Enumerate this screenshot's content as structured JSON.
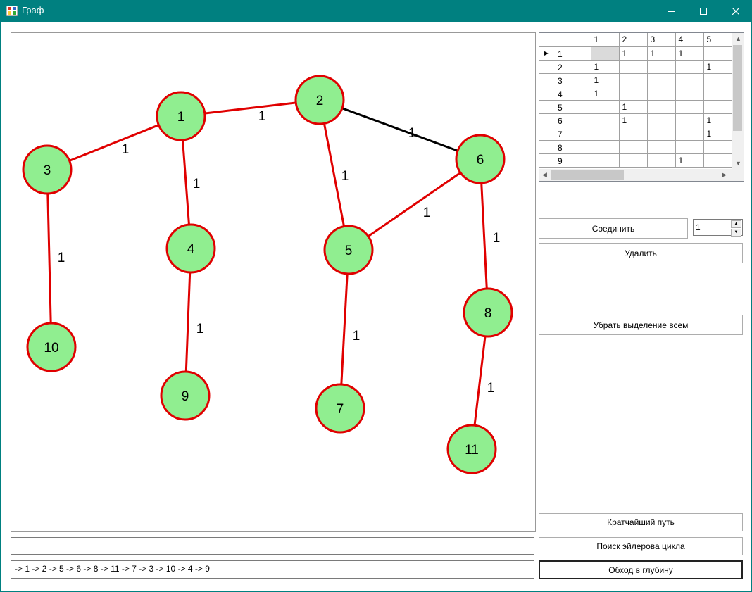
{
  "window": {
    "title": "Граф"
  },
  "grid": {
    "columns": [
      "1",
      "2",
      "3",
      "4",
      "5"
    ],
    "rows": [
      {
        "label": "1",
        "cells": [
          "",
          "1",
          "1",
          "1",
          ""
        ]
      },
      {
        "label": "2",
        "cells": [
          "1",
          "",
          "",
          "",
          "1"
        ]
      },
      {
        "label": "3",
        "cells": [
          "1",
          "",
          "",
          "",
          ""
        ]
      },
      {
        "label": "4",
        "cells": [
          "1",
          "",
          "",
          "",
          ""
        ]
      },
      {
        "label": "5",
        "cells": [
          "",
          "1",
          "",
          "",
          ""
        ]
      },
      {
        "label": "6",
        "cells": [
          "",
          "1",
          "",
          "",
          "1"
        ]
      },
      {
        "label": "7",
        "cells": [
          "",
          "",
          "",
          "",
          "1"
        ]
      },
      {
        "label": "8",
        "cells": [
          "",
          "",
          "",
          "",
          ""
        ]
      },
      {
        "label": "9",
        "cells": [
          "",
          "",
          "",
          "1",
          ""
        ]
      }
    ]
  },
  "controls": {
    "connect_label": "Соединить",
    "weight_value": "1",
    "delete_label": "Удалить",
    "deselect_label": "Убрать выделение всем",
    "shortest_path_label": "Кратчайший путь",
    "euler_label": "Поиск эйлерова цикла",
    "dfs_label": "Обход в глубину"
  },
  "output": {
    "line1": "",
    "line2": "-> 1 -> 2 -> 5 -> 6 -> 8 -> 11 -> 7 -> 3 -> 10 -> 4 -> 9"
  },
  "graph": {
    "node_fill": "#90ee90",
    "node_stroke": "#e00000",
    "highlight_edge_color": "#e00000",
    "normal_edge_color": "#000000",
    "nodes": [
      "1",
      "2",
      "3",
      "4",
      "5",
      "6",
      "7",
      "8",
      "9",
      "10",
      "11"
    ],
    "edges": [
      {
        "from": "1",
        "to": "2",
        "weight": "1",
        "highlighted": true
      },
      {
        "from": "1",
        "to": "3",
        "weight": "1",
        "highlighted": true
      },
      {
        "from": "1",
        "to": "4",
        "weight": "1",
        "highlighted": true
      },
      {
        "from": "2",
        "to": "6",
        "weight": "1",
        "highlighted": false
      },
      {
        "from": "2",
        "to": "5",
        "weight": "1",
        "highlighted": true
      },
      {
        "from": "5",
        "to": "6",
        "weight": "1",
        "highlighted": true
      },
      {
        "from": "6",
        "to": "8",
        "weight": "1",
        "highlighted": true
      },
      {
        "from": "3",
        "to": "10",
        "weight": "1",
        "highlighted": true
      },
      {
        "from": "4",
        "to": "9",
        "weight": "1",
        "highlighted": true
      },
      {
        "from": "5",
        "to": "7",
        "weight": "1",
        "highlighted": true
      },
      {
        "from": "8",
        "to": "11",
        "weight": "1",
        "highlighted": true
      }
    ]
  }
}
